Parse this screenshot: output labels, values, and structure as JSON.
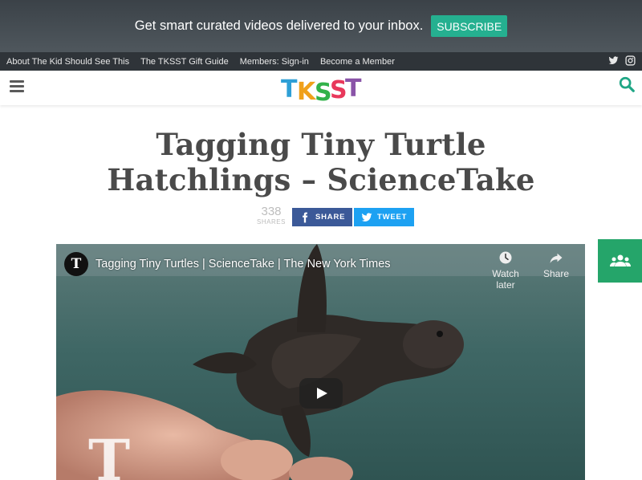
{
  "promo": {
    "text": "Get smart curated videos delivered to your inbox.",
    "subscribe_label": "SUBSCRIBE"
  },
  "topnav": {
    "links": [
      "About The Kid Should See This",
      "The TKSST Gift Guide",
      "Members: Sign-in",
      "Become a Member"
    ]
  },
  "header": {
    "logo_text": "TKSST"
  },
  "article": {
    "title_line1": "Tagging Tiny Turtle",
    "title_line2": "Hatchlings – ScienceTake",
    "shares_count": "338",
    "shares_label": "SHARES",
    "share_label": "SHARE",
    "tweet_label": "TWEET"
  },
  "video": {
    "channel_logo": "T",
    "title": "Tagging Tiny Turtles | ScienceTake | The New York Times",
    "watch_later_label": "Watch later",
    "share_label": "Share"
  },
  "colors": {
    "accent_green": "#25b090",
    "facebook": "#3b5998",
    "twitter": "#1da1f2",
    "community": "#25a56a"
  }
}
